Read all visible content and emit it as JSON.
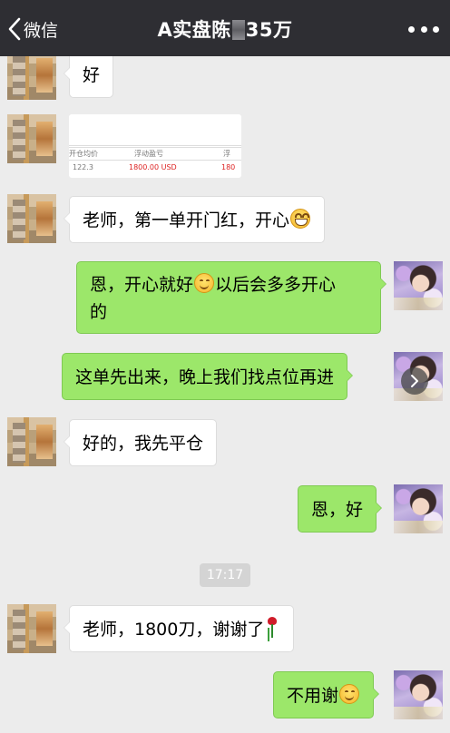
{
  "header": {
    "back_label": "微信",
    "title_prefix": "A实盘陈",
    "title_suffix": "35万"
  },
  "messages": [
    {
      "side": "left",
      "type": "text",
      "text": "好"
    },
    {
      "side": "left",
      "type": "image",
      "image_cells": {
        "col1": "开仓均价",
        "col2": "浮动盈亏",
        "col3": "浮",
        "val1": "122.3",
        "val2": "1800.00 USD",
        "val3": "180"
      }
    },
    {
      "side": "left",
      "type": "text",
      "text": "老师，第一单开门红，开心",
      "emoji": "grin"
    },
    {
      "side": "right",
      "type": "text",
      "line1_a": "恩，开心就好",
      "emoji": "smile",
      "line1_b": "以后会多多开心",
      "line2": "的"
    },
    {
      "side": "right",
      "type": "text",
      "text": "这单先出来，晚上我们找点位再进"
    },
    {
      "side": "left",
      "type": "text",
      "text": "好的，我先平仓"
    },
    {
      "side": "right",
      "type": "text",
      "text": "恩，好"
    },
    {
      "side": "left",
      "type": "text",
      "text": "老师，1800刀，谢谢了",
      "emoji": "rose"
    },
    {
      "side": "right",
      "type": "text",
      "text": "不用谢",
      "emoji": "smile"
    }
  ],
  "timestamp": "17:17",
  "colors": {
    "header_bg": "#2e2e33",
    "chat_bg": "#ececec",
    "bubble_right": "#9ce76a",
    "bubble_left": "#ffffff"
  }
}
